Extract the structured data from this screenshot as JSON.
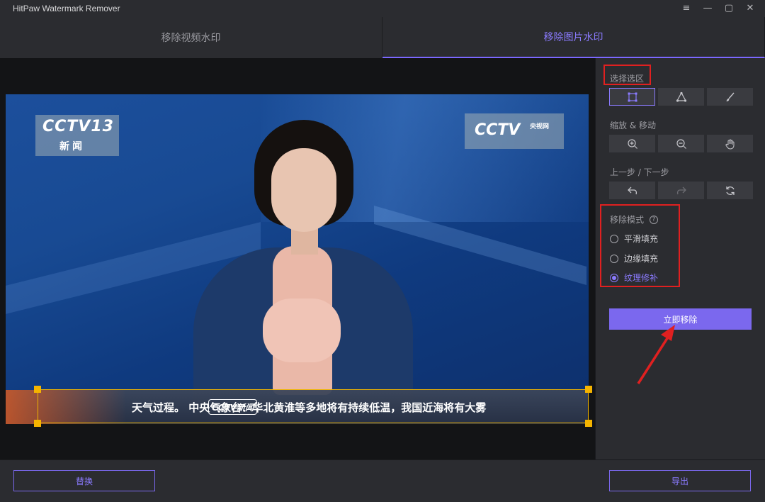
{
  "app": {
    "title": "HitPaw Watermark Remover"
  },
  "window_controls": [
    "menu-icon",
    "minimize-icon",
    "maximize-icon",
    "close-icon"
  ],
  "tabs": [
    {
      "label": "移除视频水印",
      "active": false
    },
    {
      "label": "移除图片水印",
      "active": true
    }
  ],
  "preview": {
    "logo_left_big": "CCTV13",
    "logo_left_small": "新闻",
    "logo_right_big": "CCTV",
    "logo_right_small": "央视网",
    "ticker_text": "天气过程。     中央气象台：华北黄淮等多地将有持续低温，我国近海将有大雾",
    "ticker_mark": "CCTV新闻"
  },
  "panel": {
    "select_label": "选择选区",
    "select_tools": [
      "rectangle-select-icon",
      "polygon-select-icon",
      "brush-icon"
    ],
    "zoom_label": "缩放 & 移动",
    "zoom_tools": [
      "zoom-in-icon",
      "zoom-out-icon",
      "hand-icon"
    ],
    "history_label": "上一步 / 下一步",
    "history_tools": [
      "undo-icon",
      "redo-icon",
      "reset-icon"
    ],
    "mode_label": "移除模式",
    "modes": [
      {
        "label": "平滑填充",
        "checked": false
      },
      {
        "label": "边缘填充",
        "checked": false
      },
      {
        "label": "纹理修补",
        "checked": true
      }
    ],
    "remove_button": "立即移除"
  },
  "bottom": {
    "replace_button": "替换",
    "export_button": "导出"
  },
  "colors": {
    "accent": "#7b68ee",
    "highlight": "#e02020",
    "selection": "#f5b400"
  }
}
